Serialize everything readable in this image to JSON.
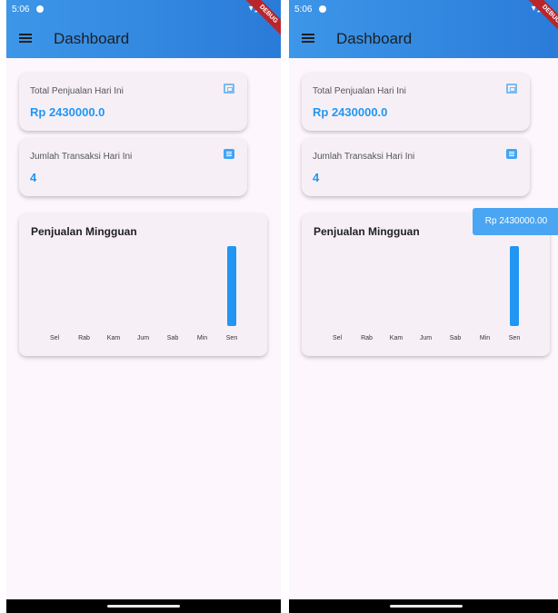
{
  "status": {
    "time": "5:06",
    "icons": "▾◢▮",
    "debug_label": "DEBUG"
  },
  "appbar": {
    "title": "Dashboard"
  },
  "cards": {
    "sales": {
      "label": "Total Penjualan Hari Ini",
      "value": "Rp 2430000.0",
      "icon": "money-icon"
    },
    "transactions": {
      "label": "Jumlah Transaksi Hari Ini",
      "value": "4",
      "icon": "receipt-icon"
    }
  },
  "tooltip": {
    "text": "Rp 2430000.00"
  },
  "colors": {
    "accent": "#2196f3",
    "appbar": "#3d96e8",
    "background": "#fdf6fd"
  },
  "chart_data": {
    "type": "bar",
    "title": "Penjualan Mingguan",
    "categories": [
      "Sel",
      "Rab",
      "Kam",
      "Jum",
      "Sab",
      "Min",
      "Sen"
    ],
    "values": [
      0,
      0,
      0,
      0,
      0,
      0,
      2430000
    ],
    "ylim": [
      0,
      2430000
    ],
    "grid": false
  }
}
